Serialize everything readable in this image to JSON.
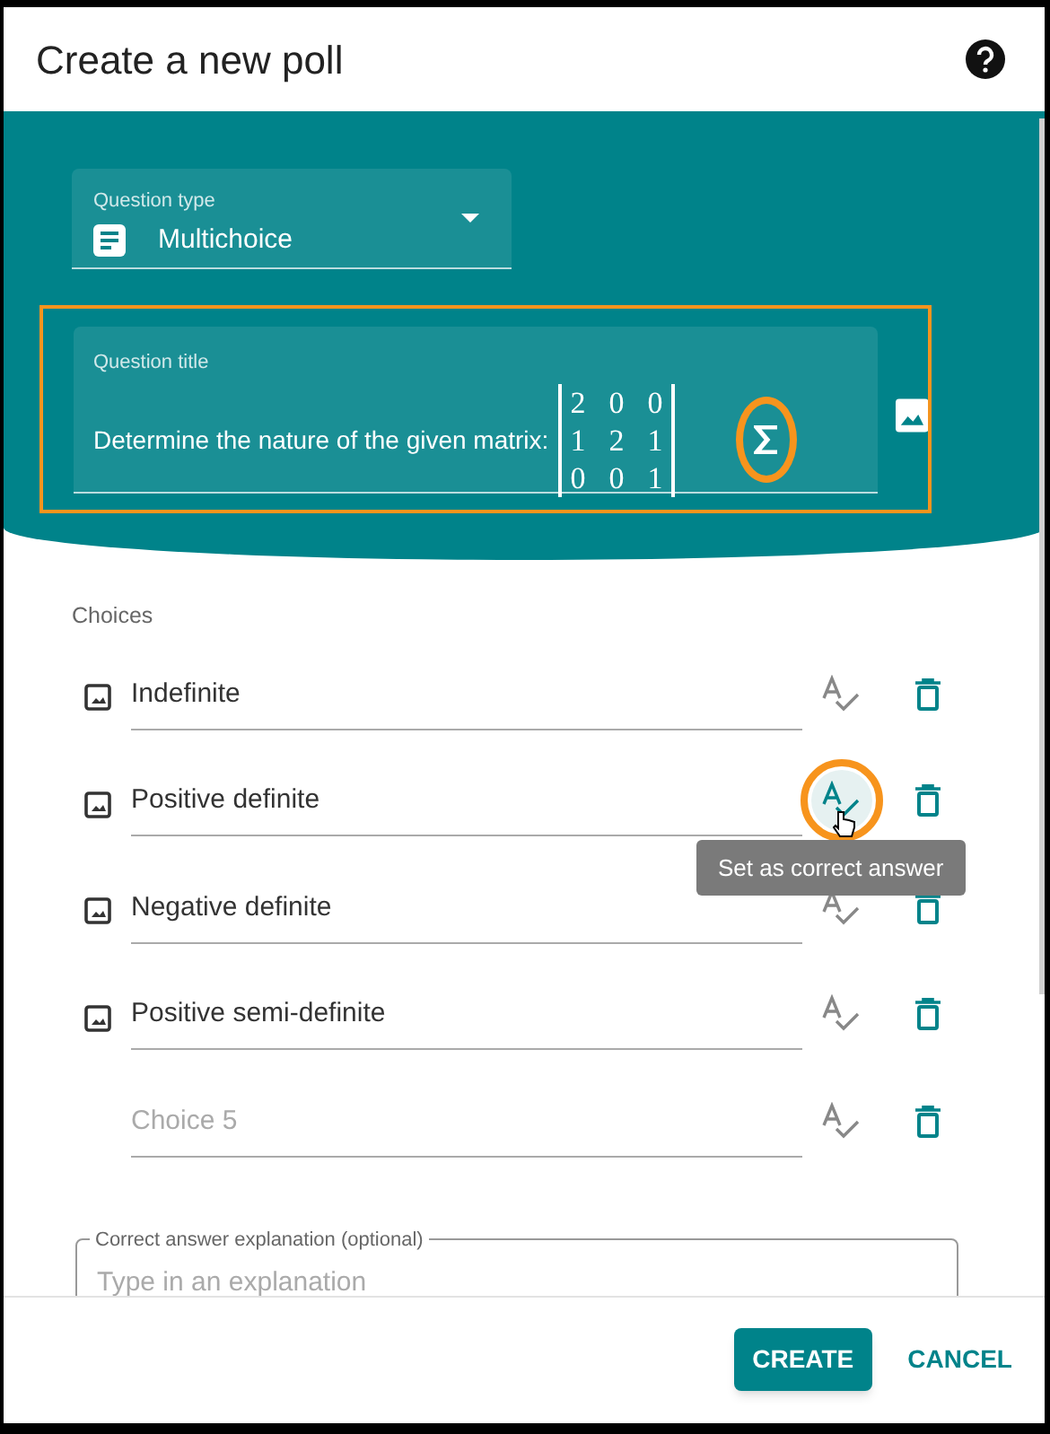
{
  "dialog": {
    "title": "Create a new poll"
  },
  "question_type": {
    "label": "Question type",
    "value": "Multichoice"
  },
  "question_title": {
    "label": "Question title",
    "text": "Determine the nature of the given matrix:",
    "circled": true,
    "matrix": [
      [
        "2",
        "0",
        "0"
      ],
      [
        "1",
        "2",
        "1"
      ],
      [
        "0",
        "0",
        "1"
      ]
    ],
    "math_button_circled": true
  },
  "choices_label": "Choices",
  "choices": [
    {
      "value": "Indefinite",
      "hovered": false,
      "circled": false
    },
    {
      "value": "Positive definite",
      "hovered": true,
      "circled": true
    },
    {
      "value": "Negative definite",
      "hovered": false,
      "circled": false
    },
    {
      "value": "Positive semi-definite",
      "hovered": false,
      "circled": false
    },
    {
      "placeholder": "Choice 5",
      "hovered": false,
      "circled": false
    }
  ],
  "tooltip": "Set as correct answer",
  "explanation": {
    "label": "Correct answer explanation (optional)",
    "placeholder": "Type in an explanation"
  },
  "buttons": [
    {
      "label": "CREATE",
      "kind": "primary"
    },
    {
      "label": "CANCEL",
      "kind": "text"
    }
  ]
}
